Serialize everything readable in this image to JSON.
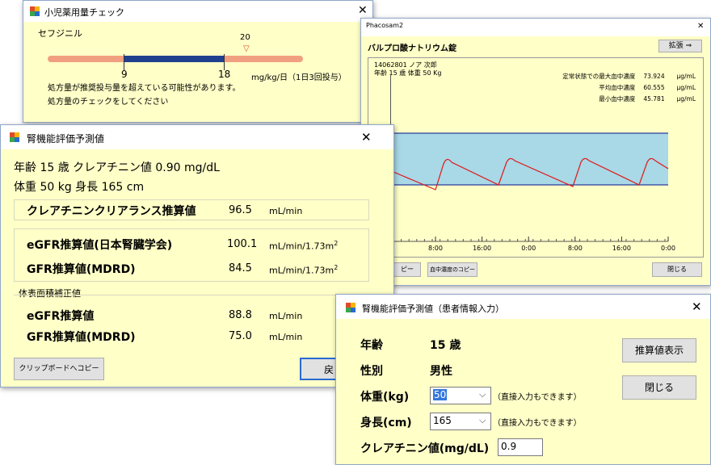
{
  "pediatric": {
    "title": "小児薬用量チェック",
    "drug": "セフジニル",
    "marker_value": "20",
    "tick_low": "9",
    "tick_high": "18",
    "unit": "mg/kg/日（1日3回投与）",
    "warning1": "処方量が推奨投与量を超えている可能性があります。",
    "warning2": "処方量のチェックをしてください"
  },
  "phacosam": {
    "title": "Phacosam2",
    "drug": "バルプロ酸ナトリウム錠",
    "expand_button": "拡張 ⇒",
    "patient_line1": "14062801  ノア  次郎",
    "patient_line2": "年齢 15 歳    体重 50 Kg",
    "stats": [
      {
        "label": "定常状態での最大血中濃度",
        "value": "73.924",
        "unit": "μg/mL"
      },
      {
        "label": "平均血中濃度",
        "value": "60.555",
        "unit": "μg/mL"
      },
      {
        "label": "最小血中濃度",
        "value": "45.781",
        "unit": "μg/mL"
      }
    ],
    "x_ticks": [
      "8:00",
      "16:00",
      "0:00",
      "8:00",
      "16:00",
      "0:00"
    ],
    "copy_button": "ピー",
    "conc_copy_button": "血中濃度のコピー",
    "close_button": "閉じる"
  },
  "renal": {
    "title": "腎機能評価予測値",
    "line1": "年齢 15 歳  クレアチニン値 0.90 mg/dL",
    "line2": "体重 50 kg  身長 165 cm",
    "ccr_label": "クレアチニンクリアランス推算値",
    "ccr_value": "96.5",
    "ccr_unit": "mL/min",
    "egfr_label": "eGFR推算値(日本腎臓学会)",
    "egfr_value": "100.1",
    "egfr_unit": "mL/min/1.73m",
    "gfr_label": "GFR推算値(MDRD)",
    "gfr_value": "84.5",
    "gfr_unit": "mL/min/1.73m",
    "sup": "2",
    "bsa_group": "体表面積補正値",
    "bsa_egfr_label": "eGFR推算値",
    "bsa_egfr_value": "88.8",
    "bsa_egfr_unit": "mL/min",
    "bsa_gfr_label": "GFR推算値(MDRD)",
    "bsa_gfr_value": "75.0",
    "bsa_gfr_unit": "mL/min",
    "clipboard_button": "クリップボードへコピー",
    "partial_button": "戻"
  },
  "input": {
    "title": "腎機能評価予測値（患者情報入力）",
    "age_label": "年齢",
    "age_value": "15 歳",
    "sex_label": "性別",
    "sex_value": "男性",
    "weight_label": "体重(kg)",
    "weight_value": "50",
    "weight_note": "（直接入力もできます）",
    "height_label": "身長(cm)",
    "height_value": "165",
    "height_note": "（直接入力もできます）",
    "cr_label": "クレアチニン値(mg/dL)",
    "cr_value": "0.9",
    "estimate_button": "推算値表示",
    "close_button": "閉じる"
  },
  "colors": {
    "window_bg": "#ffffc8",
    "bar_salmon": "#f0a080",
    "bar_blue": "#1f3f8f",
    "plot_fill": "#a9d8e6",
    "curve_red": "#e01818",
    "plot_band_line": "#2a3f9f"
  }
}
